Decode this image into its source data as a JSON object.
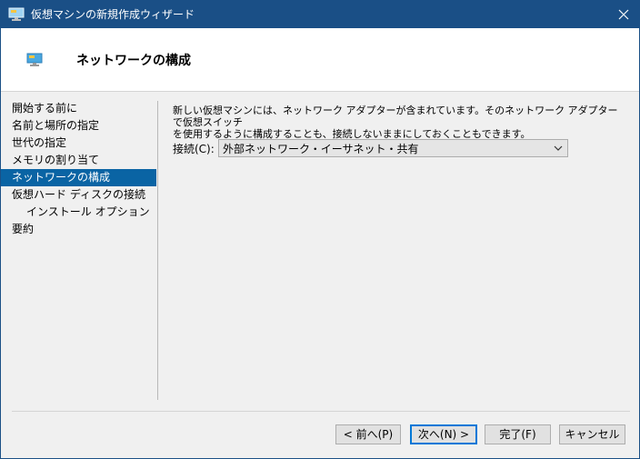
{
  "window": {
    "title": "仮想マシンの新規作成ウィザード"
  },
  "header": {
    "title": "ネットワークの構成"
  },
  "nav": {
    "items": [
      {
        "label": "開始する前に"
      },
      {
        "label": "名前と場所の指定"
      },
      {
        "label": "世代の指定"
      },
      {
        "label": "メモリの割り当て"
      },
      {
        "label": "ネットワークの構成"
      },
      {
        "label": "仮想ハード ディスクの接続"
      },
      {
        "label": "インストール オプション"
      },
      {
        "label": "要約"
      }
    ],
    "active_index": 4
  },
  "content": {
    "description": "新しい仮想マシンには、ネットワーク アダプターが含まれています。そのネットワーク アダプターで仮想スイッチ\nを使用するように構成することも、接続しないままにしておくこともできます。",
    "connection_label": "接続(C):",
    "connection_value": "外部ネットワーク・イーサネット・共有"
  },
  "buttons": {
    "prev": "< 前へ(P)",
    "next": "次へ(N) >",
    "finish": "完了(F)",
    "cancel": "キャンセル"
  },
  "colors": {
    "titlebar": "#1a4f86",
    "selection": "#0a64a4",
    "accent": "#0078d7"
  },
  "icons": {
    "window": "monitor-icon",
    "header": "monitor-icon",
    "close": "close-icon",
    "dropdown": "chevron-down-icon"
  }
}
